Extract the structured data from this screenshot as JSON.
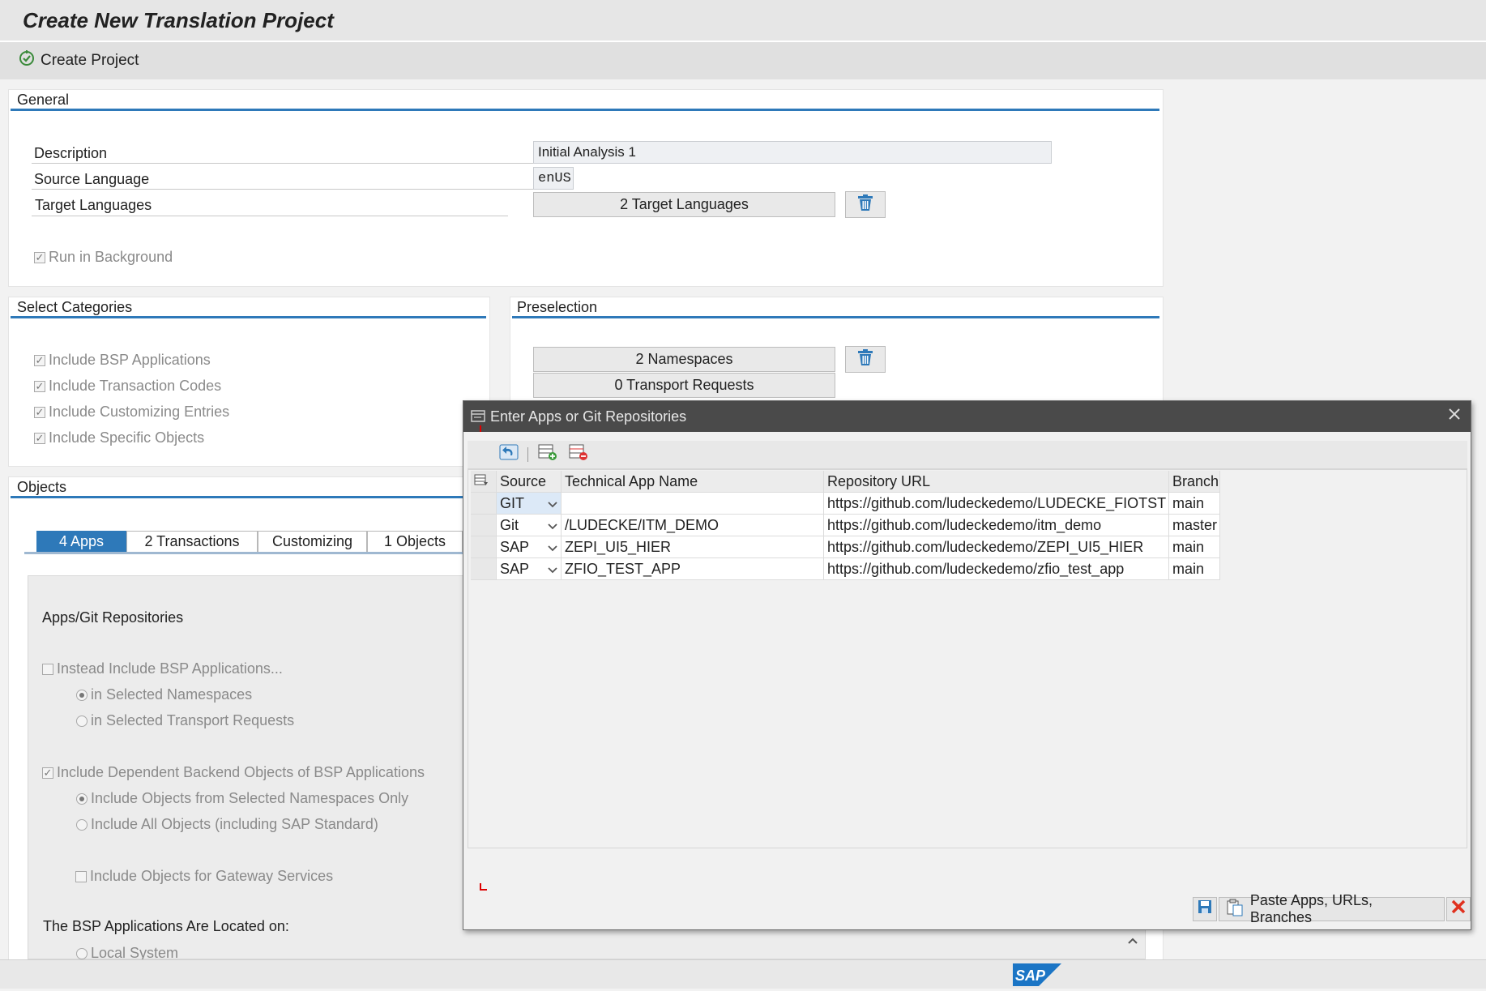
{
  "window": {
    "title": "Create New Translation Project"
  },
  "toolbar": {
    "create_project": "Create Project"
  },
  "general": {
    "title": "General",
    "description_label": "Description",
    "description_value": "Initial Analysis 1",
    "source_language_label": "Source Language",
    "source_language_value": "enUS",
    "target_languages_label": "Target Languages",
    "target_languages_button": "2  Target Languages",
    "run_in_background": "Run in Background"
  },
  "categories": {
    "title": "Select Categories",
    "items": [
      "Include BSP Applications",
      "Include Transaction Codes",
      "Include Customizing Entries",
      "Include Specific Objects"
    ]
  },
  "preselection": {
    "title": "Preselection",
    "namespaces_button": "2  Namespaces",
    "transport_button": "0  Transport Requests"
  },
  "objects": {
    "title": "Objects",
    "tabs": [
      "4  Apps",
      "2  Transactions",
      "Customizing",
      "1  Objects"
    ],
    "apps_heading": "Apps/Git Repositories",
    "instead_include": "Instead Include BSP Applications...",
    "radio_ns": "in Selected Namespaces",
    "radio_tr": "in Selected Transport Requests",
    "include_dependent": "Include Dependent Backend Objects of BSP Applications",
    "radio_only_ns": "Include Objects from Selected Namespaces Only",
    "radio_all": "Include All Objects (including SAP Standard)",
    "gateway": "Include Objects for Gateway Services",
    "located_heading": "The BSP Applications Are Located on:",
    "local_system": "Local System"
  },
  "dialog": {
    "title": "Enter Apps or Git Repositories",
    "columns": [
      "Source",
      "Technical App Name",
      "Repository URL",
      "Branch"
    ],
    "rows": [
      {
        "source": "GIT",
        "app": "",
        "url": "https://github.com/ludeckedemo/LUDECKE_FIOTST",
        "branch": "main"
      },
      {
        "source": "Git",
        "app": "/LUDECKE/ITM_DEMO",
        "url": "https://github.com/ludeckedemo/itm_demo",
        "branch": "master"
      },
      {
        "source": "SAP",
        "app": "ZEPI_UI5_HIER",
        "url": "https://github.com/ludeckedemo/ZEPI_UI5_HIER",
        "branch": "main"
      },
      {
        "source": "SAP",
        "app": "ZFIO_TEST_APP",
        "url": "https://github.com/ludeckedemo/zfio_test_app",
        "branch": "main"
      }
    ],
    "paste_button": "Paste Apps, URLs, Branches"
  },
  "colors": {
    "accent": "#2e79b9",
    "dialog_header": "#4a4a4a",
    "cancel": "#e0301e"
  },
  "brand": {
    "logo": "SAP"
  }
}
